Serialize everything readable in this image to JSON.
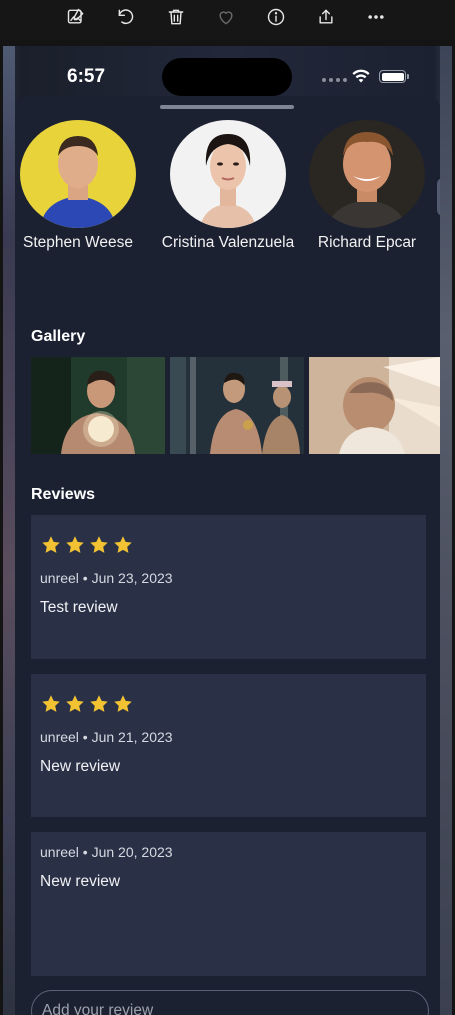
{
  "toolbar": {
    "icons": [
      "edit-image-icon",
      "rotate-icon",
      "trash-icon",
      "heart-icon",
      "info-icon",
      "share-icon",
      "more-icon"
    ]
  },
  "status": {
    "time": "6:57"
  },
  "cast": [
    {
      "name": "Stephen Weese"
    },
    {
      "name": "Cristina Valenzuela"
    },
    {
      "name": "Richard Epcar"
    }
  ],
  "gallery": {
    "title": "Gallery"
  },
  "reviews": {
    "title": "Reviews",
    "items": [
      {
        "meta": "unreel • Jun 23, 2023",
        "text": "Test review",
        "rating": 4
      },
      {
        "meta": "unreel • Jun 21, 2023",
        "text": "New review",
        "rating": 4
      },
      {
        "meta": "unreel • Jun 20, 2023",
        "text": "New review",
        "rating": 0
      }
    ]
  },
  "input": {
    "placeholder": "Add your review"
  },
  "colors": {
    "star": "#f2c233",
    "sheet": "#1c2131",
    "card": "#2a3147"
  }
}
